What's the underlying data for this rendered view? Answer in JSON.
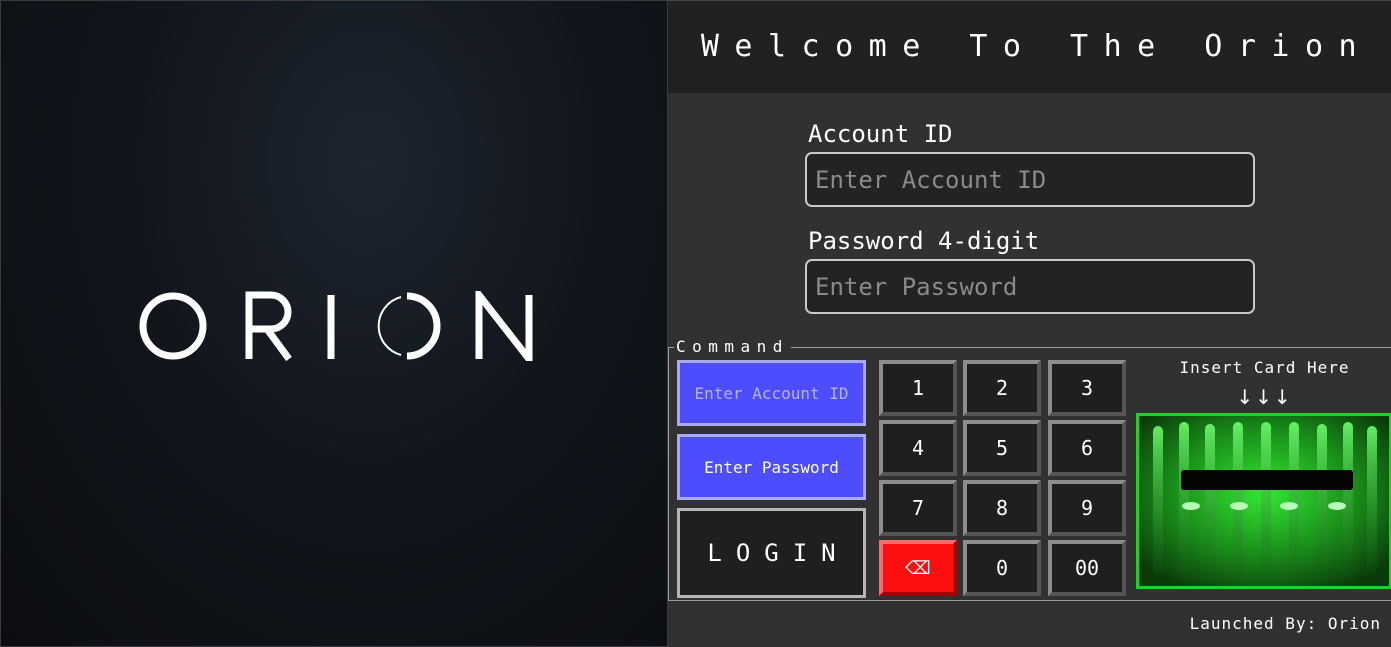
{
  "splash": {
    "logo_text": "ORION"
  },
  "header": {
    "title": "Welcome To The Orion"
  },
  "form": {
    "account_label": "Account ID",
    "account_placeholder": "Enter Account ID",
    "password_label": "Password 4-digit",
    "password_placeholder": "Enter Password"
  },
  "command": {
    "legend": "Command",
    "enter_account_label": "Enter Account ID",
    "enter_password_label": "Enter Password",
    "login_label": "LOGIN"
  },
  "keypad": {
    "keys": [
      "1",
      "2",
      "3",
      "4",
      "5",
      "6",
      "7",
      "8",
      "9",
      "⌫",
      "0",
      "00"
    ]
  },
  "card_reader": {
    "label": "Insert Card Here",
    "arrows": "↓↓↓"
  },
  "footer": {
    "launched_by": "Launched By: Orion"
  },
  "colors": {
    "command_button": "#4d4dff",
    "delete_key": "#ff1010",
    "card_reader_glow": "#25d025"
  }
}
